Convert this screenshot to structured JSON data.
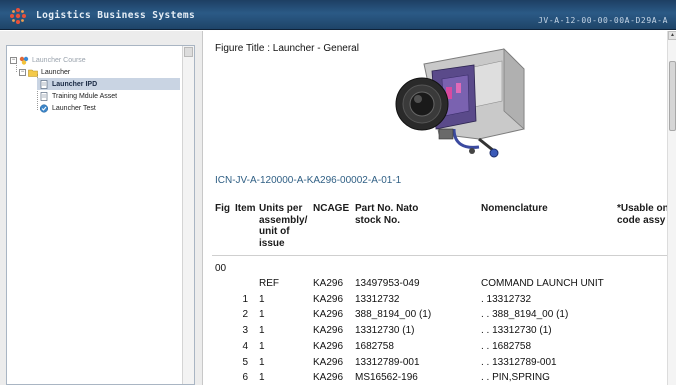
{
  "titlebar": {
    "app_title": "Logistics Business Systems",
    "doc_code": "JV-A-12-00-00-00A-D29A-A"
  },
  "tree": {
    "items": [
      {
        "label": "Launcher Course",
        "icon": "course-icon",
        "state": "muted"
      },
      {
        "label": "Launcher",
        "icon": "folder-icon"
      },
      {
        "label": "Launcher IPD",
        "icon": "document-icon",
        "state": "selected"
      },
      {
        "label": "Training Mdule Asset",
        "icon": "document-icon"
      },
      {
        "label": "Launcher Test",
        "icon": "test-icon"
      }
    ]
  },
  "content": {
    "figure_title": "Figure Title : Launcher - General",
    "icn": "ICN-JV-A-120000-A-KA296-00002-A-01-1",
    "headers": {
      "fig_item": "Fig Item",
      "units": "Units per assembly/ unit of issue",
      "ncage": "NCAGE",
      "part": "Part No. Nato stock No.",
      "nomenclature": "Nomenclature",
      "usable": "*Usable on code assy"
    },
    "group": "00",
    "rows": [
      {
        "item": "",
        "units": "REF",
        "ncage": "KA296",
        "part": "13497953-049",
        "nomenclature": "COMMAND LAUNCH UNIT"
      },
      {
        "item": "1",
        "units": "1",
        "ncage": "KA296",
        "part": "13312732",
        "nomenclature": ". 13312732"
      },
      {
        "item": "2",
        "units": "1",
        "ncage": "KA296",
        "part": "388_8194_00 (1)",
        "nomenclature": ". . 388_8194_00 (1)"
      },
      {
        "item": "3",
        "units": "1",
        "ncage": "KA296",
        "part": "13312730 (1)",
        "nomenclature": ". . 13312730 (1)"
      },
      {
        "item": "4",
        "units": "1",
        "ncage": "KA296",
        "part": "1682758",
        "nomenclature": ". . 1682758"
      },
      {
        "item": "5",
        "units": "1",
        "ncage": "KA296",
        "part": "13312789-001",
        "nomenclature": ". . 13312789-001"
      },
      {
        "item": "6",
        "units": "1",
        "ncage": "KA296",
        "part": "MS16562-196",
        "nomenclature": ". . PIN,SPRING"
      }
    ]
  }
}
